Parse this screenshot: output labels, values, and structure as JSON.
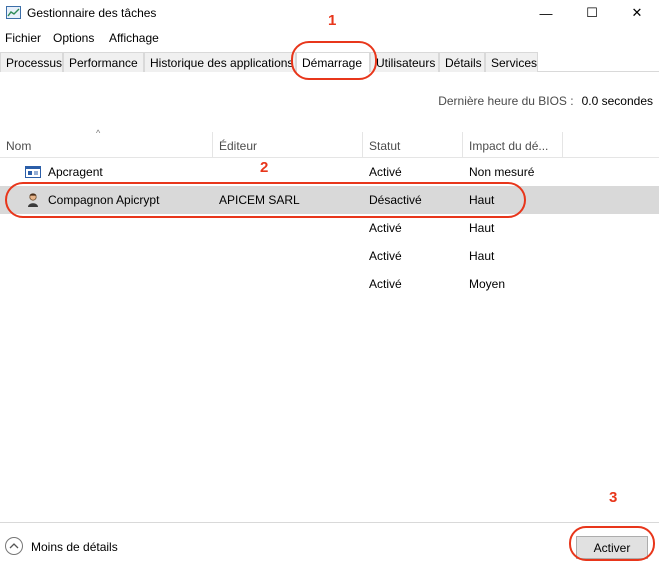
{
  "window": {
    "title": "Gestionnaire des tâches",
    "minimize": "—",
    "maximize": "☐",
    "close": "✕"
  },
  "menu": [
    "Fichier",
    "Options",
    "Affichage"
  ],
  "tabs": [
    "Processus",
    "Performance",
    "Historique des applications",
    "Démarrage",
    "Utilisateurs",
    "Détails",
    "Services"
  ],
  "active_tab": "Démarrage",
  "bios": {
    "label": "Dernière heure du BIOS :",
    "value": "0.0 secondes"
  },
  "columns": [
    "Nom",
    "Éditeur",
    "Statut",
    "Impact du dé..."
  ],
  "rows": [
    {
      "name": "Apcragent",
      "publisher": "",
      "status": "Activé",
      "impact": "Non mesuré",
      "icon": "window-icon"
    },
    {
      "name": "Compagnon Apicrypt",
      "publisher": "APICEM SARL",
      "status": "Désactivé",
      "impact": "Haut",
      "icon": "person-icon"
    },
    {
      "name": "",
      "publisher": "",
      "status": "Activé",
      "impact": "Haut",
      "icon": ""
    },
    {
      "name": "",
      "publisher": "",
      "status": "Activé",
      "impact": "Haut",
      "icon": ""
    },
    {
      "name": "",
      "publisher": "",
      "status": "Activé",
      "impact": "Moyen",
      "icon": ""
    }
  ],
  "footer": {
    "fewer_details": "Moins de détails",
    "activate": "Activer"
  },
  "annotations": [
    "1",
    "2",
    "3"
  ],
  "colors": {
    "annotation": "#e8361b",
    "selected_row": "#d9d9d9"
  }
}
